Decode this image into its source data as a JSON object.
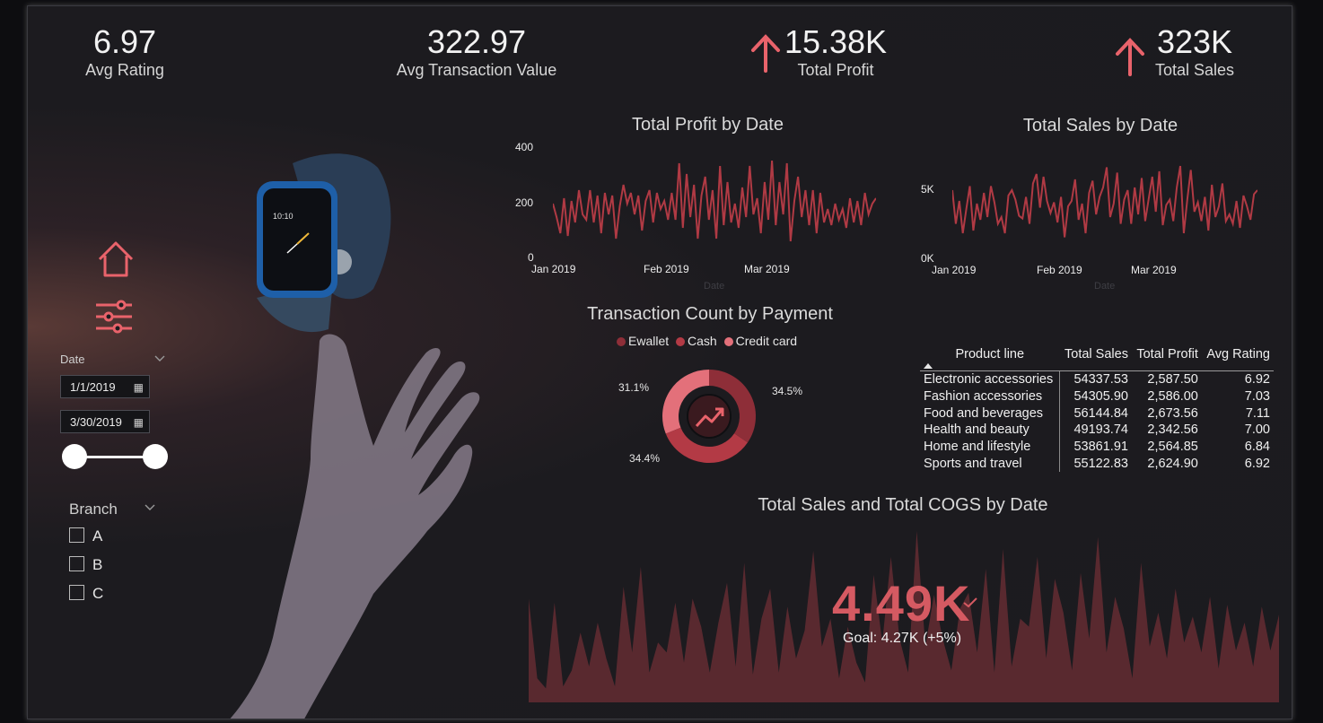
{
  "kpis": {
    "avg_rating": {
      "value": "6.97",
      "label": "Avg Rating"
    },
    "avg_transaction": {
      "value": "322.97",
      "label": "Avg Transaction Value"
    },
    "total_profit": {
      "value": "15.38K",
      "label": "Total Profit"
    },
    "total_sales": {
      "value": "323K",
      "label": "Total Sales"
    }
  },
  "icons": {
    "nav_home": "home-icon",
    "nav_filters": "sliders-icon",
    "kpi_trend": "arrow-up-icon",
    "donut_center": "trend-up-icon",
    "calendar": "calendar-icon",
    "goal_check": "check-icon"
  },
  "colors": {
    "accent": "#e9636b",
    "line": "#b03a44",
    "donut_ewallet": "#8e2e38",
    "donut_cash": "#b33a45",
    "donut_credit": "#e3707a"
  },
  "slicers": {
    "date_label": "Date",
    "start_date": "1/1/2019",
    "end_date": "3/30/2019",
    "branch_label": "Branch",
    "branches": [
      "A",
      "B",
      "C"
    ]
  },
  "profit_chart": {
    "title": "Total Profit by Date",
    "y_ticks": [
      "400",
      "200",
      "0"
    ],
    "x_ticks": [
      "Jan 2019",
      "Feb 2019",
      "Mar 2019"
    ],
    "x_title": "Date"
  },
  "sales_chart": {
    "title": "Total Sales by Date",
    "y_ticks": [
      "5K",
      "0K"
    ],
    "x_ticks": [
      "Jan 2019",
      "Feb 2019",
      "Mar 2019"
    ],
    "x_title": "Date"
  },
  "payment_chart": {
    "title": "Transaction Count by Payment",
    "legend": [
      "Ewallet",
      "Cash",
      "Credit card"
    ],
    "labels": [
      "34.5%",
      "34.4%",
      "31.1%"
    ]
  },
  "product_table": {
    "headers": [
      "Product line",
      "Total Sales",
      "Total Profit",
      "Avg Rating"
    ],
    "rows": [
      [
        "Electronic accessories",
        "54337.53",
        "2,587.50",
        "6.92"
      ],
      [
        "Fashion accessories",
        "54305.90",
        "2,586.00",
        "7.03"
      ],
      [
        "Food and beverages",
        "56144.84",
        "2,673.56",
        "7.11"
      ],
      [
        "Health and beauty",
        "49193.74",
        "2,342.56",
        "7.00"
      ],
      [
        "Home and lifestyle",
        "53861.91",
        "2,564.85",
        "6.84"
      ],
      [
        "Sports and travel",
        "55122.83",
        "2,624.90",
        "6.92"
      ]
    ]
  },
  "cogs_chart": {
    "title": "Total Sales and Total COGS by Date",
    "value": "4.49K",
    "goal": "Goal: 4.27K (+5%)"
  },
  "chart_data": [
    {
      "type": "line",
      "title": "Total Profit by Date",
      "xlabel": "Date",
      "ylim": [
        0,
        400
      ],
      "x_ticks": [
        "Jan 2019",
        "Feb 2019",
        "Mar 2019"
      ],
      "series": [
        {
          "values": [
            200,
            150,
            90,
            220,
            80,
            210,
            130,
            250,
            160,
            140,
            250,
            130,
            230,
            90,
            240,
            160,
            230,
            70,
            190,
            270,
            200,
            240,
            160,
            230,
            100,
            210,
            250,
            130,
            240,
            180,
            210,
            140,
            240,
            140,
            350,
            110,
            310,
            150,
            270,
            70,
            230,
            300,
            140,
            250,
            70,
            340,
            120,
            280,
            130,
            200,
            110,
            260,
            150,
            340,
            160,
            220,
            90,
            280,
            140,
            360,
            120,
            280,
            160,
            350,
            60,
            210,
            300,
            150,
            250,
            120,
            250,
            90,
            240,
            130,
            180,
            120,
            200,
            140,
            180,
            110,
            220,
            130,
            210,
            120,
            240,
            160,
            200,
            220
          ]
        }
      ]
    },
    {
      "type": "line",
      "title": "Total Sales by Date",
      "xlabel": "Date",
      "ylim": [
        0,
        8000
      ],
      "x_ticks": [
        "Jan 2019",
        "Feb 2019",
        "Mar 2019"
      ],
      "series": [
        {
          "values": [
            5000,
            2500,
            4200,
            1800,
            3600,
            5300,
            2000,
            4000,
            2800,
            4800,
            3000,
            5300,
            4100,
            2500,
            3000,
            1800,
            4600,
            5000,
            4300,
            3100,
            2900,
            4500,
            2500,
            5500,
            6200,
            3700,
            6000,
            4200,
            3300,
            4100,
            2600,
            4500,
            1500,
            3800,
            4200,
            5800,
            2800,
            4000,
            1800,
            4800,
            5700,
            3200,
            4500,
            5200,
            6700,
            3000,
            4000,
            6300,
            2500,
            4300,
            5000,
            2500,
            5200,
            3200,
            5900,
            2700,
            4400,
            6000,
            3400,
            6400,
            2400,
            3900,
            4300,
            2700,
            5200,
            6800,
            1800,
            4300,
            6500,
            3400,
            4100,
            2700,
            4500,
            2000,
            5400,
            3000,
            3800,
            5500,
            2700,
            3200,
            2500,
            4200,
            2200,
            4600,
            3800,
            2800,
            4700,
            5000
          ]
        }
      ]
    },
    {
      "type": "pie",
      "title": "Transaction Count by Payment",
      "categories": [
        "Ewallet",
        "Cash",
        "Credit card"
      ],
      "values": [
        34.5,
        34.4,
        31.1
      ]
    },
    {
      "type": "area",
      "title": "Total Sales and Total COGS by Date",
      "series": [
        {
          "values": [
            5200,
            1200,
            700,
            5000,
            800,
            1600,
            3500,
            1800,
            4000,
            2200,
            800,
            5800,
            2500,
            6800,
            1500,
            3000,
            2500,
            5000,
            2000,
            5200,
            3800,
            1500,
            4000,
            6000,
            1800,
            7000,
            1400,
            4200,
            5700,
            1500,
            4800,
            2200,
            3600,
            7600,
            2800,
            4200,
            1200,
            3800,
            2000,
            1000,
            6400,
            3000,
            7300,
            3200,
            1500,
            8600,
            2800,
            5400,
            3200,
            1600,
            4700,
            5500,
            2500,
            6700,
            1500,
            7700,
            1800,
            4200,
            3800,
            7300,
            2200,
            6200,
            4500,
            1600,
            6500,
            3200,
            8300,
            2500,
            5300,
            3700,
            1200,
            7000,
            2800,
            4500,
            2200,
            5700,
            3000,
            4300,
            2500,
            5300,
            1700,
            4900,
            2600,
            4000,
            1800,
            4800,
            2600,
            4400
          ]
        }
      ]
    },
    {
      "type": "table",
      "columns": [
        "Product line",
        "Total Sales",
        "Total Profit",
        "Avg Rating"
      ],
      "rows": [
        [
          "Electronic accessories",
          54337.53,
          2587.5,
          6.92
        ],
        [
          "Fashion accessories",
          54305.9,
          2586.0,
          7.03
        ],
        [
          "Food and beverages",
          56144.84,
          2673.56,
          7.11
        ],
        [
          "Health and beauty",
          49193.74,
          2342.56,
          7.0
        ],
        [
          "Home and lifestyle",
          53861.91,
          2564.85,
          6.84
        ],
        [
          "Sports and travel",
          55122.83,
          2624.9,
          6.92
        ]
      ]
    }
  ]
}
